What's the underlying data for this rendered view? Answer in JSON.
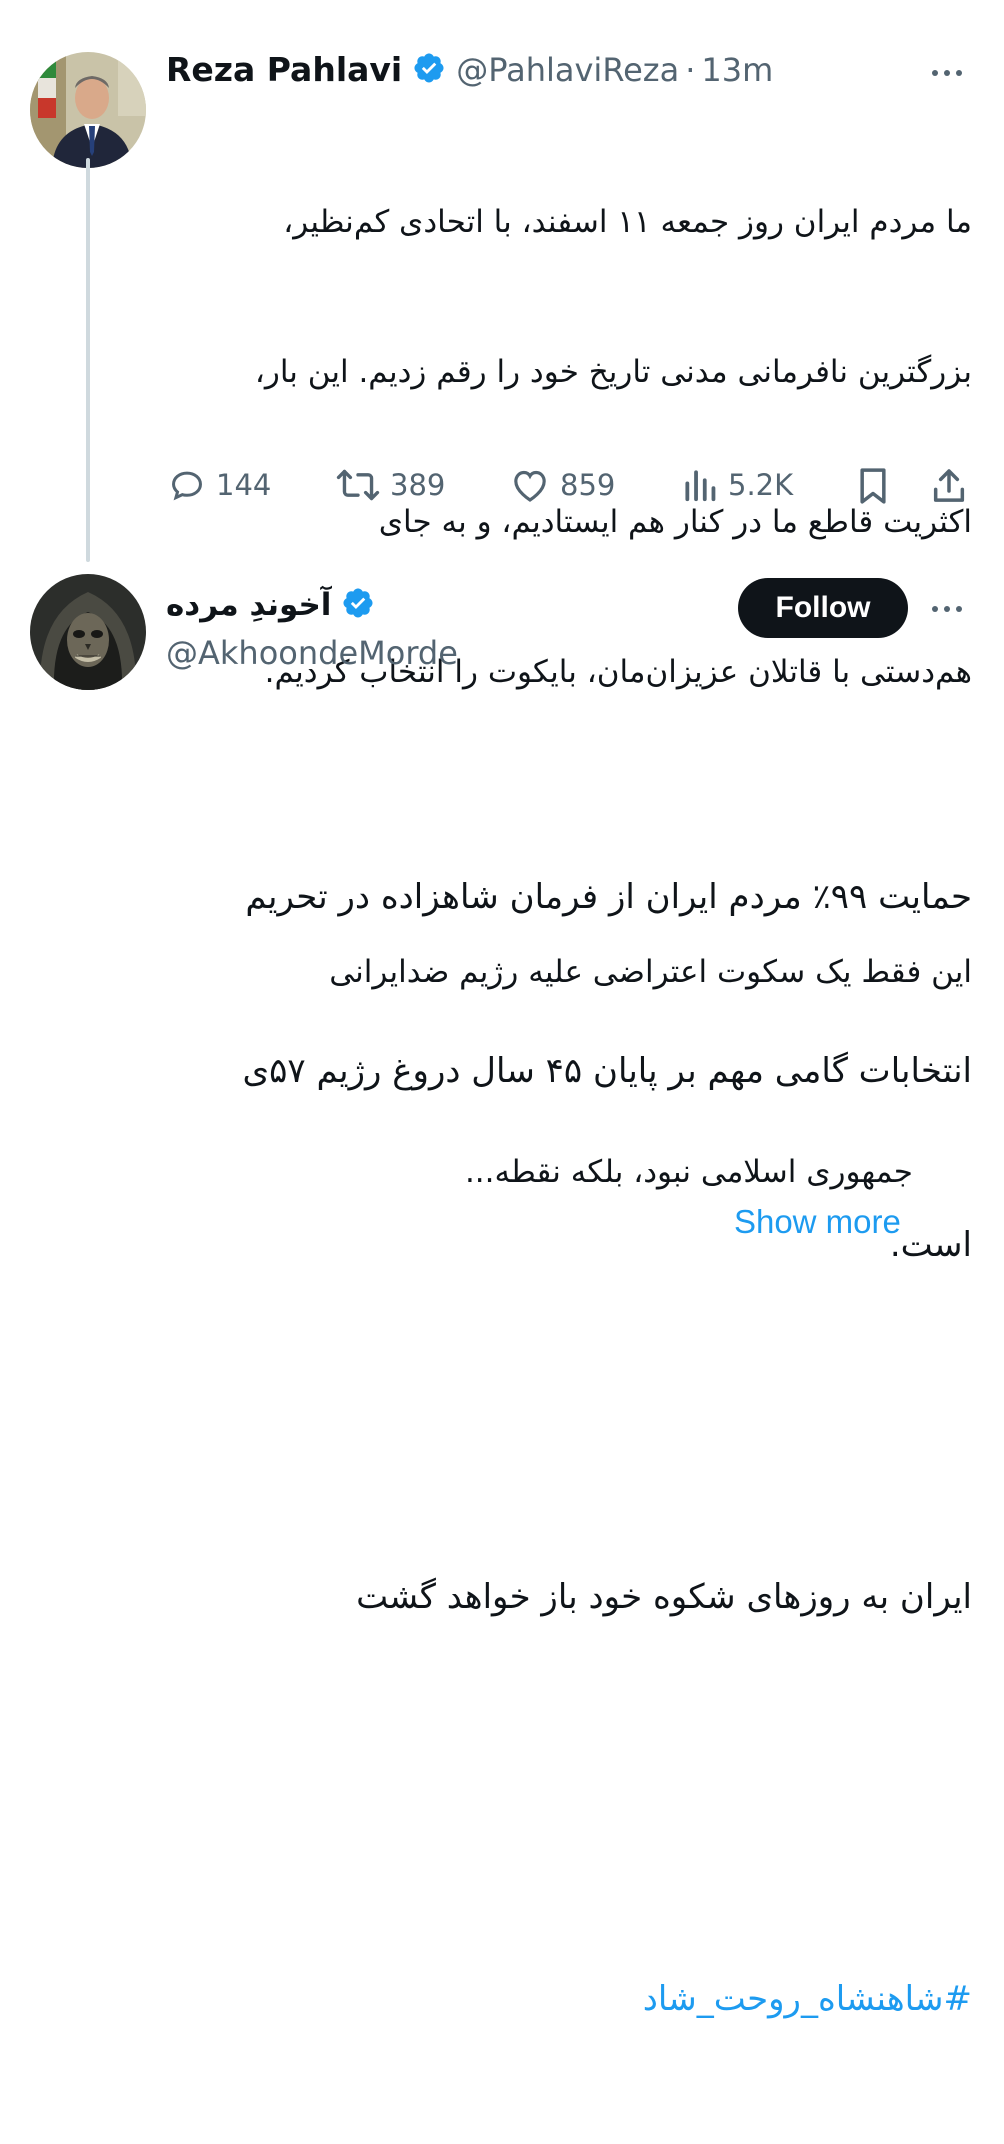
{
  "tweet1": {
    "display_name": "Reza Pahlavi",
    "handle": "@PahlaviReza",
    "separator": "·",
    "time": "13m",
    "body_lines": [
      "ما مردم ایران روز جمعه ۱۱ اسفند، با اتحادی کم‌نظیر،",
      "بزرگترین نافرمانی مدنی تاریخ خود را رقم زدیم. این بار،",
      "اکثریت قاطع ما در کنار هم ایستادیم، و به جای",
      "هم‌دستی با قاتلان عزیزان‌مان، بایکوت را انتخاب کردیم.",
      "",
      "این فقط یک سکوت اعتراضی علیه رژیم ضدایرانی",
      "جمهوری اسلامی نبود، بلکه نقطه..."
    ],
    "show_more": "Show more",
    "stats": {
      "replies": "144",
      "retweets": "389",
      "likes": "859",
      "views": "5.2K"
    }
  },
  "tweet2": {
    "display_name": "آخوندِ مرده",
    "handle": "@AkhoondeMorde",
    "follow_label": "Follow",
    "body_lines": [
      "حمایت ۹۹٪ مردم ایران از فرمان شاهزاده در تحریم",
      "انتخابات گامی مهم بر پایان ۴۵ سال دروغ رژیم ۵۷ی",
      "است.",
      "",
      "ایران به روزهای شکوه خود باز خواهد گشت"
    ],
    "hashtag": "#شاهنشاه_روحت_شاد"
  },
  "icons": {
    "verified": "verified-badge-icon",
    "reply": "reply-icon",
    "retweet": "retweet-icon",
    "like": "heart-icon",
    "views": "views-icon",
    "bookmark": "bookmark-icon",
    "share": "share-icon",
    "more": "more-icon"
  },
  "colors": {
    "accent": "#1d9bf0",
    "text": "#0f1419",
    "secondary": "#536471",
    "follow_bg": "#0f1419"
  }
}
